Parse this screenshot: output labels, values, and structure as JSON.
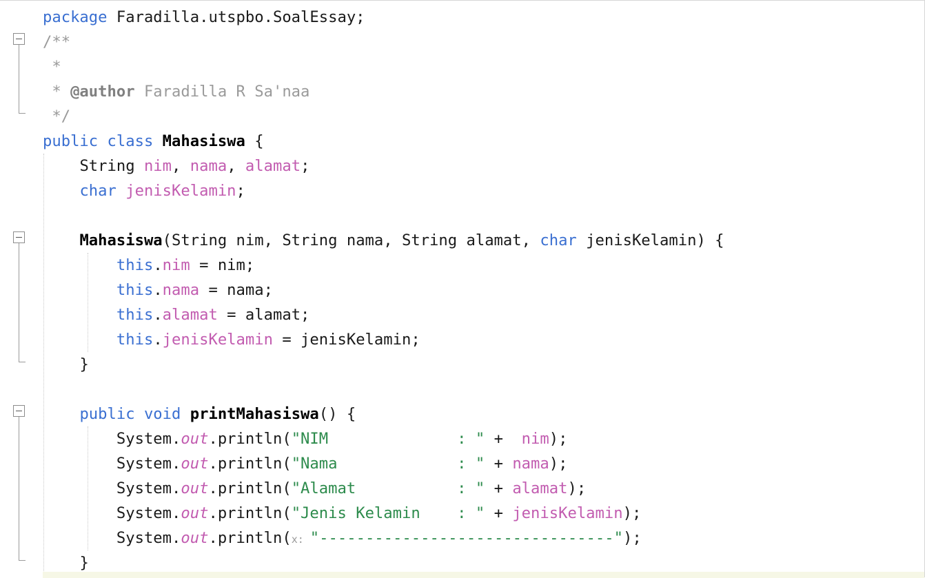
{
  "code": {
    "package_kw": "package",
    "package_name": "Faradilla.utspbo.SoalEssay;",
    "doc_open": "/**",
    "doc_star": "*",
    "doc_author_prefix": "* ",
    "doc_author_tag": "@author",
    "doc_author_name": " Faradilla R Sa'naa",
    "doc_close": "*/",
    "public": "public",
    "class": "class",
    "class_name": "Mahasiswa",
    "brace_open": " {",
    "string_type": "String",
    "fields": [
      "nim",
      "nama",
      "alamat"
    ],
    "char_type": "char",
    "field_jk": "jenisKelamin",
    "ctor_name": "Mahasiswa",
    "ctor_params_1": "(String nim, String nama, String alamat, ",
    "ctor_params_2": " jenisKelamin) {",
    "this_kw": "this",
    "assign": [
      {
        "field": "nim",
        "rhs": " = nim;"
      },
      {
        "field": "nama",
        "rhs": " = nama;"
      },
      {
        "field": "alamat",
        "rhs": " = alamat;"
      },
      {
        "field": "jenisKelamin",
        "rhs": " = jenisKelamin;"
      }
    ],
    "close_brace": "}",
    "void_kw": "void",
    "method_name": "printMahasiswa",
    "method_rest": "() {",
    "system": "System.",
    "out": "out",
    "println": ".println(",
    "prints": [
      {
        "label": "\"NIM              : \"",
        "op": " +  ",
        "var": "nim",
        "end": ");"
      },
      {
        "label": "\"Nama             : \"",
        "op": " + ",
        "var": "nama",
        "end": ");"
      },
      {
        "label": "\"Alamat           : \"",
        "op": " + ",
        "var": "alamat",
        "end": ");"
      },
      {
        "label": "\"Jenis Kelamin    : \"",
        "op": " + ",
        "var": "jenisKelamin",
        "end": ");"
      }
    ],
    "param_hint": "x: ",
    "dash_string": "\"--------------------------------\"",
    "dash_end": ");"
  },
  "colors": {
    "keyword": "#3a6fd1",
    "field": "#c25cb0",
    "comment": "#9a9a9a",
    "string": "#2d8b4c"
  }
}
